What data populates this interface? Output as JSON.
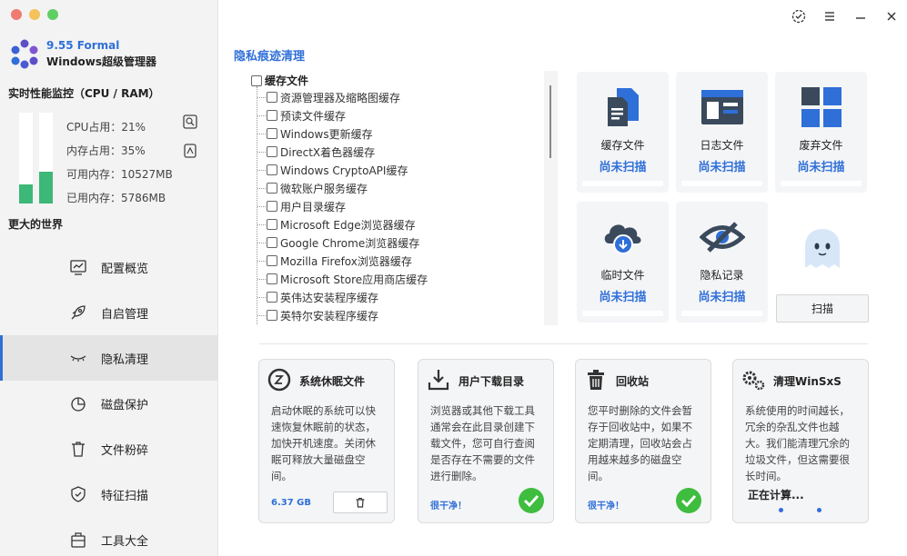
{
  "app": {
    "version": "9.55 Formal",
    "name": "Windows超级管理器"
  },
  "perf": {
    "title": "实时性能监控（CPU / RAM）",
    "cpu_label": "CPU占用：21%",
    "cpu_percent": 21,
    "mem_label": "内存占用：35%",
    "mem_percent": 35,
    "avail_label": "可用内存：10527MB",
    "used_label": "已用内存：5786MB",
    "tagline": "更大的世界",
    "colors": {
      "bar_fill": "#3cb878"
    }
  },
  "nav": {
    "items": [
      {
        "label": "配置概览",
        "icon": "chart-icon"
      },
      {
        "label": "自启管理",
        "icon": "rocket-icon"
      },
      {
        "label": "隐私清理",
        "icon": "eye-closed-icon",
        "active": true
      },
      {
        "label": "磁盘保护",
        "icon": "pie-chart-icon"
      },
      {
        "label": "文件粉碎",
        "icon": "trash-icon"
      },
      {
        "label": "特征扫描",
        "icon": "shield-icon"
      },
      {
        "label": "工具大全",
        "icon": "toolbox-icon"
      }
    ]
  },
  "titlebar": {
    "icons": [
      "badge-check-icon",
      "menu-icon",
      "minimize-icon",
      "close-icon"
    ]
  },
  "privacy": {
    "title": "隐私痕迹清理",
    "tree_root": "缓存文件",
    "tree_items": [
      "资源管理器及缩略图缓存",
      "预读文件缓存",
      "Windows更新缓存",
      "DirectX着色器缓存",
      "Windows CryptoAPI缓存",
      "微软账户服务缓存",
      "用户目录缓存",
      "Microsoft Edge浏览器缓存",
      "Google Chrome浏览器缓存",
      "Mozilla Firefox浏览器缓存",
      "Microsoft Store应用商店缓存",
      "英伟达安装程序缓存",
      "英特尔安装程序缓存"
    ],
    "cards": [
      {
        "label": "缓存文件",
        "status": "尚未扫描",
        "icon": "document-stack-icon"
      },
      {
        "label": "日志文件",
        "status": "尚未扫描",
        "icon": "log-window-icon"
      },
      {
        "label": "废弃文件",
        "status": "尚未扫描",
        "icon": "grid-tiles-icon"
      },
      {
        "label": "临时文件",
        "status": "尚未扫描",
        "icon": "cloud-download-icon"
      },
      {
        "label": "隐私记录",
        "status": "尚未扫描",
        "icon": "eye-slash-icon"
      }
    ],
    "scan_button": "扫描",
    "colors": {
      "accent": "#2f6fd8",
      "check_green": "#3ebd3e"
    }
  },
  "panels": [
    {
      "title": "系统休眠文件",
      "icon": "sleep-icon",
      "desc": "启动休眠的系统可以快速恢复休眠前的状态，加快开机速度。关闭休眠可释放大量磁盘空间。",
      "footer": "6.37 GB"
    },
    {
      "title": "用户下载目录",
      "icon": "download-tray-icon",
      "desc": "浏览器或其他下载工具通常会在此目录创建下载文件，您可自行查阅是否存在不需要的文件进行删除。",
      "footer": "很干净！"
    },
    {
      "title": "回收站",
      "icon": "recycle-bin-icon",
      "desc": "您平时删除的文件会暂存于回收站中，如果不定期清理，回收站会占用越来越多的磁盘空间。",
      "footer": "很干净！"
    },
    {
      "title": "清理WinSxS",
      "icon": "gears-icon",
      "desc": "系统使用的时间越长，冗余的杂乱文件也越大。我们能清理冗余的垃圾文件，但这需要很长时间。",
      "footer": "正在计算..."
    }
  ]
}
